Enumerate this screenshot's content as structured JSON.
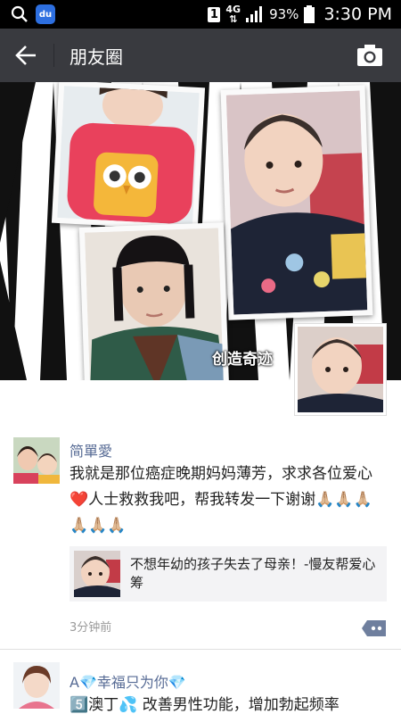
{
  "status_bar": {
    "sim_slot": "1",
    "network": "4G",
    "battery": "93%",
    "time": "3:30 PM",
    "icons": [
      "search-icon",
      "baidu-app-icon",
      "signal-icon",
      "battery-icon"
    ]
  },
  "header": {
    "title": "朋友圈",
    "back_icon": "back-arrow-icon",
    "camera_icon": "camera-icon"
  },
  "cover": {
    "caption": "创造奇迹"
  },
  "posts": [
    {
      "author": "简單愛",
      "text": "我就是那位癌症晚期妈妈薄芳，求求各位爱心❤️人士救救我吧，帮我转发一下谢谢🙏🏼🙏🏼🙏🏼🙏🏼🙏🏼🙏🏼",
      "link_title": "不想年幼的孩子失去了母亲！-慢友帮爱心筹",
      "time": "3分钟前"
    },
    {
      "author": "A💎幸福只为你💎",
      "text": "5️⃣澳丁💦 改善男性功能，增加勃起频率"
    }
  ],
  "colors": {
    "title_bar": "#393a3f",
    "author_link": "#576b95",
    "link_card_bg": "#f3f3f5"
  }
}
